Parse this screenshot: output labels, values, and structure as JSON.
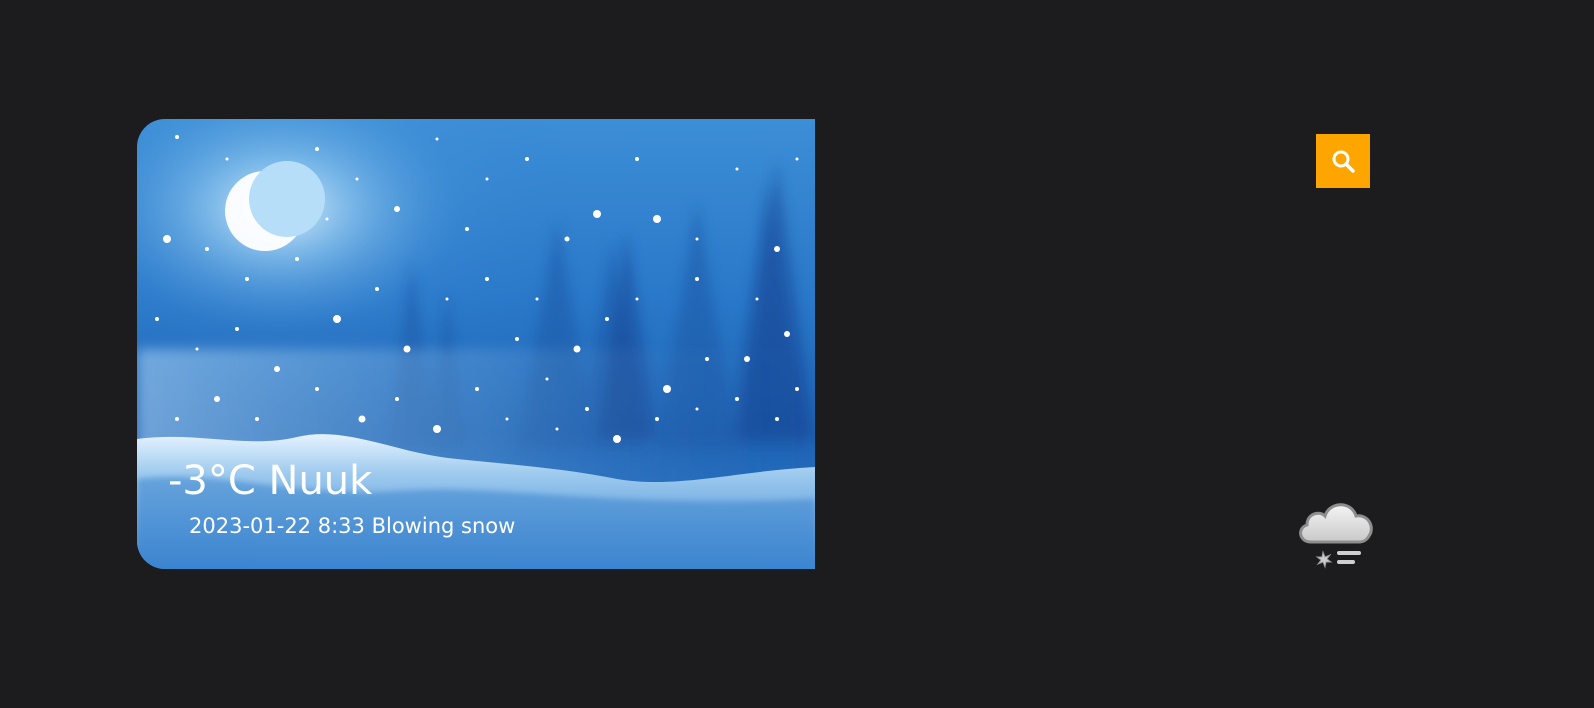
{
  "weather": {
    "temperature": "-3°C",
    "city": "Nuuk",
    "date": "2023-01-22",
    "time": "8:33",
    "condition": "Blowing snow"
  },
  "search_button": {
    "icon": "search-icon",
    "color": "#ffa500"
  },
  "condition_icon": "blowing-snow-icon",
  "colors": {
    "background": "#1c1c1e",
    "accent": "#ffa500",
    "text": "#ffffff"
  }
}
